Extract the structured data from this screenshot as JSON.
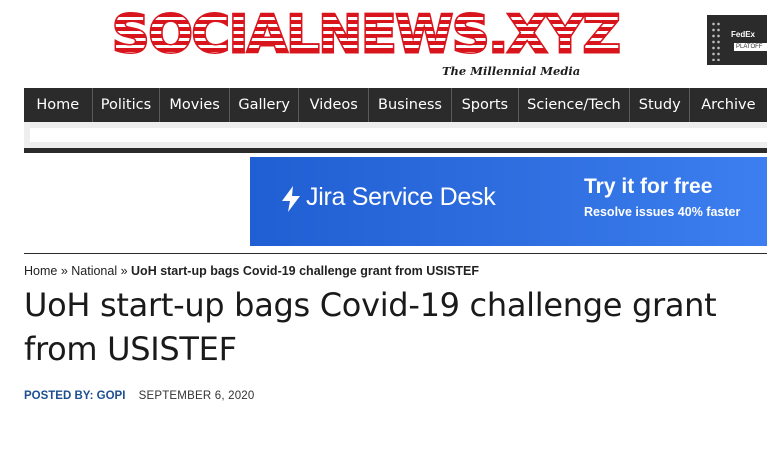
{
  "header": {
    "logo_text": "SOCIALNEWS.XYZ",
    "tagline": "The Millennial Media",
    "side_ad": {
      "text": "FedEx",
      "subtext": "PLATOFF"
    }
  },
  "nav": {
    "items": [
      {
        "label": "Home"
      },
      {
        "label": "Politics"
      },
      {
        "label": "Movies"
      },
      {
        "label": "Gallery"
      },
      {
        "label": "Videos"
      },
      {
        "label": "Business"
      },
      {
        "label": "Sports"
      },
      {
        "label": "Science/Tech"
      },
      {
        "label": "Study"
      },
      {
        "label": "Archive"
      }
    ]
  },
  "ad_banner": {
    "brand": "Jira Service Desk",
    "cta": "Try it for free",
    "sub": "Resolve issues 40% faster",
    "bg_color": "#2563d9"
  },
  "breadcrumb": {
    "home": "Home",
    "sep1": " » ",
    "section": "National",
    "sep2": " » ",
    "current": "UoH start-up bags Covid-19 challenge grant from USISTEF"
  },
  "article": {
    "title": "UoH start-up bags Covid-19 challenge grant from USISTEF",
    "posted_by_label": "POSTED BY: GOPI",
    "date": "SEPTEMBER 6, 2020"
  },
  "colors": {
    "logo_red": "#d8141c",
    "nav_bg": "#2b2b2b",
    "byline_blue": "#1d4f91"
  }
}
